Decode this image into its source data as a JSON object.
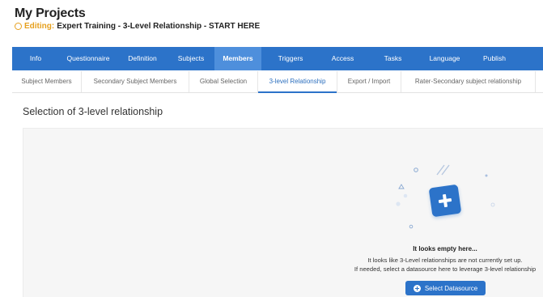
{
  "header": {
    "title": "My Projects",
    "editing_prefix": "Editing:",
    "editing_name": "Expert Training - 3-Level Relationship - START HERE"
  },
  "main_nav": {
    "active": "Members",
    "items": [
      "Info",
      "Questionnaire",
      "Definition",
      "Subjects",
      "Members",
      "Triggers",
      "Access",
      "Tasks",
      "Language",
      "Publish"
    ]
  },
  "sub_nav": {
    "active": "3-level Relationship",
    "items": [
      "Subject Members",
      "Secondary Subject Members",
      "Global Selection",
      "3-level Relationship",
      "Export / Import",
      "Rater-Secondary subject relationship"
    ]
  },
  "section_title": "Selection of 3-level relationship",
  "empty_state": {
    "heading": "It looks empty here...",
    "line1": "It looks like 3-Level relationships are not currently set up.",
    "line2": "If needed, select a datasource here to leverage 3-level relationship",
    "button_label": "Select Datasource",
    "illustration_icon": "plus-icon"
  },
  "colors": {
    "nav_bg": "#2c73c9",
    "nav_active_bg": "#4e8fdc",
    "accent": "#2c73c9",
    "editing_orange": "#e6a01e",
    "panel_bg": "#f6f6f6"
  }
}
